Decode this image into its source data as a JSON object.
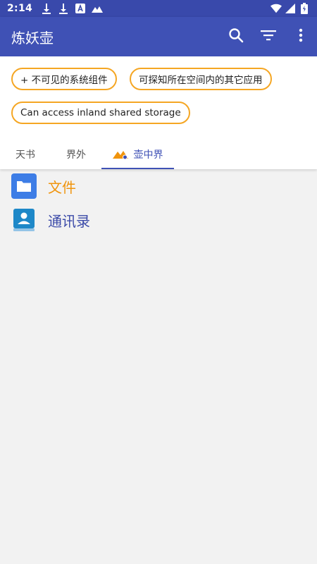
{
  "status_bar": {
    "time": "2:14",
    "icons": [
      "download-icon",
      "download-icon",
      "font-icon",
      "mountain-icon",
      "wifi-icon",
      "signal-icon",
      "battery-icon"
    ]
  },
  "app_bar": {
    "title": "炼妖壶",
    "actions": [
      "search-icon",
      "filter-icon",
      "more-vert-icon"
    ]
  },
  "chips": [
    {
      "label": "+ 不可见的系统组件"
    },
    {
      "label": "可探知所在空间内的其它应用"
    },
    {
      "label": "Can access inland shared storage"
    }
  ],
  "tabs": [
    {
      "label": "天书",
      "active": false
    },
    {
      "label": "界外",
      "active": false
    },
    {
      "label": "壶中界",
      "active": true,
      "icon": "mountain-badge-icon"
    }
  ],
  "list": [
    {
      "label": "文件",
      "icon": "folder-icon",
      "color": "#f0940c"
    },
    {
      "label": "通讯录",
      "icon": "contacts-icon",
      "color": "#3b4aa8"
    }
  ],
  "colors": {
    "status_bar": "#3949ab",
    "app_bar": "#3f51b5",
    "chip_border": "#f5a623",
    "tab_active": "#3f51b5",
    "background": "#f2f2f2"
  }
}
